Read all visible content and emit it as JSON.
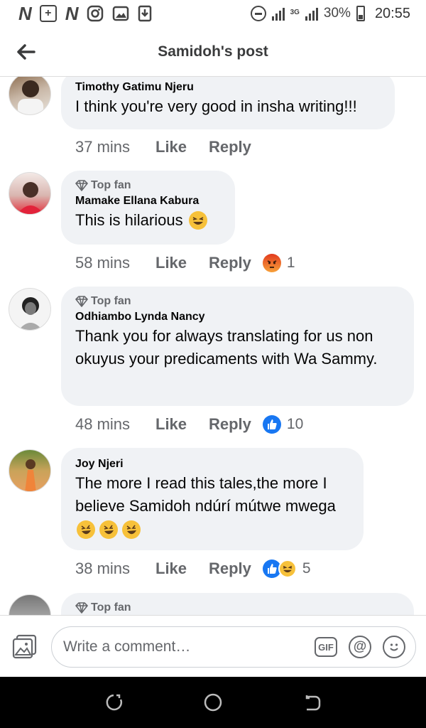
{
  "status_bar": {
    "left_icons": [
      "N",
      "+",
      "N",
      "instagram-icon",
      "gallery-icon",
      "download-icon"
    ],
    "network": "3G",
    "battery": "30%",
    "time": "20:55"
  },
  "header": {
    "title": "Samidoh's post"
  },
  "comments": [
    {
      "author": "Timothy Gatimu Njeru",
      "top_fan": "",
      "text": "I think you're very good in insha writing!!!",
      "time": "37 mins",
      "like_label": "Like",
      "reply_label": "Reply",
      "reaction_count": ""
    },
    {
      "author": "Mamake Ellana Kabura",
      "top_fan": "Top fan",
      "text": "This is hilarious",
      "time": "58 mins",
      "like_label": "Like",
      "reply_label": "Reply",
      "reaction_count": "1"
    },
    {
      "author": "Odhiambo Lynda Nancy",
      "top_fan": "Top fan",
      "text": "Thank you for always translating for us non okuyus your predicaments with Wa Sammy.",
      "time": "48 mins",
      "like_label": "Like",
      "reply_label": "Reply",
      "reaction_count": "10"
    },
    {
      "author": "Joy Njeri",
      "top_fan": "",
      "text": "The more I read this tales,the more I believe Samidoh ndúrí mútwe mwega",
      "time": "38 mins",
      "like_label": "Like",
      "reply_label": "Reply",
      "reaction_count": "5"
    },
    {
      "author": "",
      "top_fan": "Top fan",
      "text": "",
      "time": "",
      "like_label": "",
      "reply_label": "",
      "reaction_count": ""
    }
  ],
  "composer": {
    "placeholder": "Write a comment…",
    "gif_label": "GIF",
    "at_label": "@"
  },
  "colors": {
    "bubble": "#f0f2f5",
    "secondary_text": "#65676b",
    "like_blue": "#1877f2",
    "haha_yellow": "#f7c13a",
    "angry_red": "#e23a1e"
  }
}
